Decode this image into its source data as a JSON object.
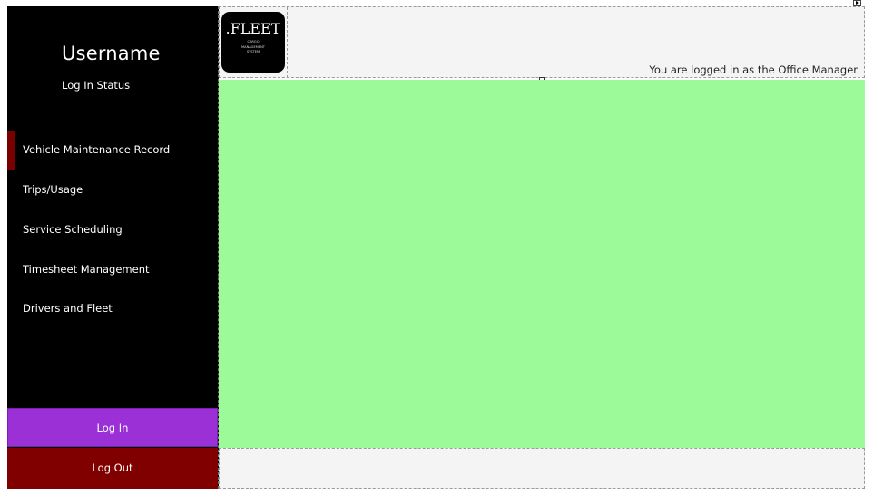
{
  "sidebar": {
    "username": "Username",
    "login_status": "Log In Status",
    "nav_items": [
      {
        "label": "Vehicle Maintenance Record",
        "active": true
      },
      {
        "label": "Trips/Usage",
        "active": false
      },
      {
        "label": "Service Scheduling",
        "active": false
      },
      {
        "label": "Timesheet Management",
        "active": false
      },
      {
        "label": "Drivers and Fleet",
        "active": false
      }
    ],
    "login_button": "Log In",
    "logout_button": "Log Out"
  },
  "header": {
    "logo": {
      "title": ".FLEET",
      "subtitle_line1": "CARGO",
      "subtitle_line2": "MANAGEMENT",
      "subtitle_line3": "SYSTEM"
    },
    "logged_in_as": "You are logged in as the Office Manager"
  },
  "colors": {
    "sidebar_bg": "#000000",
    "content_bg": "#9cfa98",
    "login_button": "#9a30d6",
    "logout_button": "#800000",
    "active_marker": "#7a0000",
    "header_bg": "#f4f4f4"
  },
  "icons": {
    "header_expand": "triangle-right-icon",
    "resize_handle": "resize-handle-icon"
  }
}
